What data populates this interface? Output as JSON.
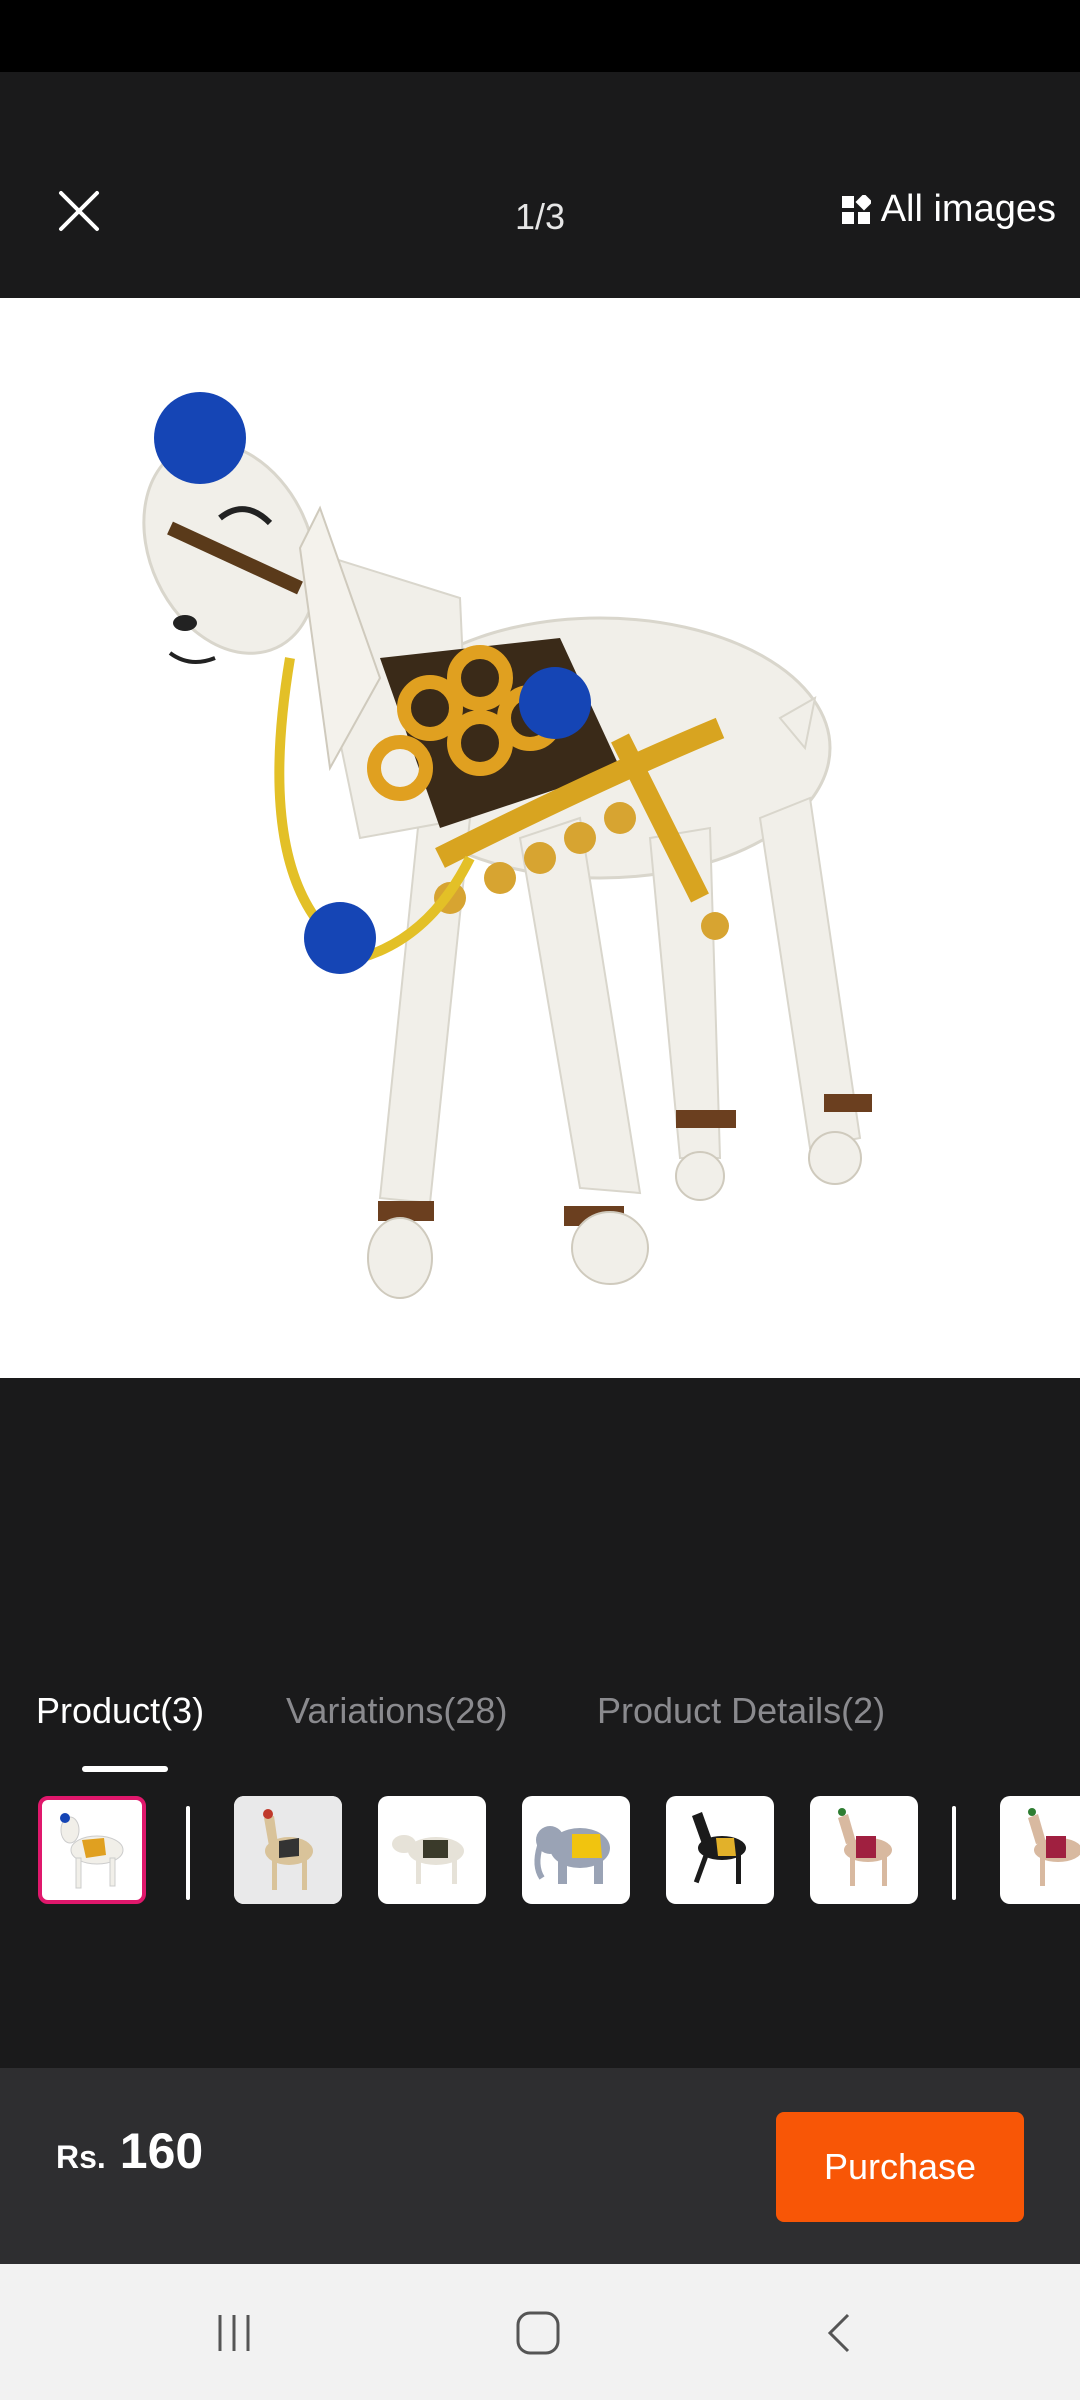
{
  "header": {
    "counter": "1/3",
    "all_images_label": "All images"
  },
  "tabs": [
    {
      "label": "Product(3)",
      "active": true
    },
    {
      "label": "Variations(28)",
      "active": false
    },
    {
      "label": "Product Details(2)",
      "active": false
    }
  ],
  "thumbnails": [
    {
      "subject": "white goat figurine with blue pom-poms and gold trim",
      "selected": true
    },
    {
      "subject": "beige camel figurine"
    },
    {
      "subject": "decorated ox figurine"
    },
    {
      "subject": "grey elephant figurine with yellow cloth"
    },
    {
      "subject": "black horse figurine with yellow saddle"
    },
    {
      "subject": "tan horse figurine with red decorations"
    },
    {
      "subject": "tan horse figurine with red decorations"
    }
  ],
  "price": {
    "currency": "Rs.",
    "value": "160"
  },
  "purchase_label": "Purchase",
  "colors": {
    "accent": "#f85606",
    "selected_border": "#e0186c",
    "background": "#1a1a1b",
    "bottom_bar": "#2e2e30"
  },
  "icons": {
    "close": "close-icon",
    "all_images": "grid-icon",
    "nav_recents": "recents-icon",
    "nav_home": "home-icon",
    "nav_back": "back-icon"
  }
}
